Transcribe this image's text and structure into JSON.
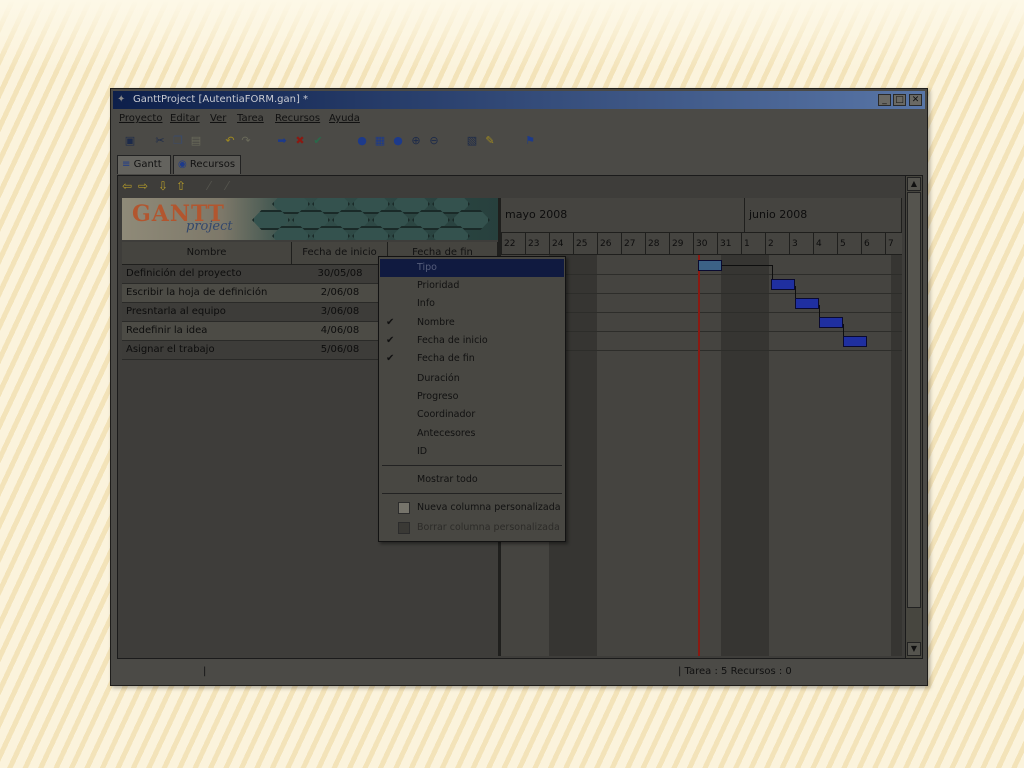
{
  "window": {
    "title": "GanttProject [AutentiaFORM.gan] *"
  },
  "menubar": {
    "items": [
      "Proyecto",
      "Editar",
      "Ver",
      "Tarea",
      "Recursos",
      "Ayuda"
    ]
  },
  "tabs": {
    "gantt": "Gantt",
    "recursos": "Recursos"
  },
  "logo": {
    "word": "GANTT",
    "sub": "project"
  },
  "table": {
    "headers": {
      "nombre": "Nombre",
      "inicio": "Fecha de inicio",
      "fin": "Fecha de fin"
    },
    "rows": [
      {
        "name": "Definición del proyecto",
        "start": "30/05/08"
      },
      {
        "name": "Escribir la hoja de definición",
        "start": "2/06/08"
      },
      {
        "name": "Presntarla al equipo",
        "start": "3/06/08"
      },
      {
        "name": "Redefinir la idea",
        "start": "4/06/08"
      },
      {
        "name": "Asignar el trabajo",
        "start": "5/06/08"
      }
    ]
  },
  "chart": {
    "months": [
      "mayo 2008",
      "junio 2008"
    ],
    "days": [
      "22",
      "23",
      "24",
      "25",
      "26",
      "27",
      "28",
      "29",
      "30",
      "31",
      "1",
      "2",
      "3",
      "4",
      "5",
      "6",
      "7"
    ]
  },
  "context_menu": {
    "items": [
      {
        "label": "Tipo",
        "checked": false,
        "selected": true
      },
      {
        "label": "Prioridad",
        "checked": false
      },
      {
        "label": "Info",
        "checked": false
      },
      {
        "label": "Nombre",
        "checked": true
      },
      {
        "label": "Fecha de inicio",
        "checked": true
      },
      {
        "label": "Fecha de fin",
        "checked": true
      },
      {
        "label": "Duración",
        "checked": false
      },
      {
        "label": "Progreso",
        "checked": false
      },
      {
        "label": "Coordinador",
        "checked": false
      },
      {
        "label": "Antecesores",
        "checked": false
      },
      {
        "label": "ID",
        "checked": false
      }
    ],
    "show_all": "Mostrar todo",
    "new_column": "Nueva columna personalizada",
    "delete_column": "Borrar columna personalizada"
  },
  "status": {
    "left": "|",
    "right": "| Tarea : 5  Recursos : 0"
  }
}
